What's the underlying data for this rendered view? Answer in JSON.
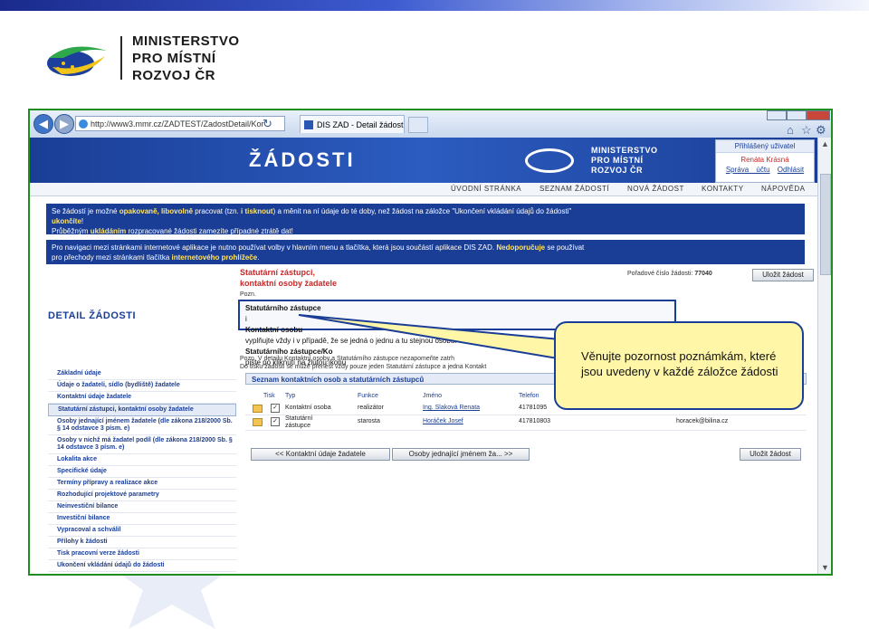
{
  "slide": {
    "brand_lines": [
      "MINISTERSTVO",
      "PRO MÍSTNÍ",
      "ROZVOJ ČR"
    ],
    "callout_text": "Věnujte pozornost poznámkám, které jsou uvedeny v každé záložce žádosti"
  },
  "browser": {
    "address": "http://www3.mmr.cz/ZADTEST/ZadostDetail/Kor",
    "tab_title": "DIS ZAD - Detail žádosti - K..."
  },
  "app": {
    "banner_title": "ŽÁDOSTI",
    "banner_brand": [
      "MINISTERSTVO",
      "PRO MÍSTNÍ",
      "ROZVOJ ČR"
    ],
    "user_box": {
      "header": "Přihlášený uživatel",
      "name": "Renáta Krásná",
      "link_account": "Správa účtu",
      "link_logout": "Odhlásit"
    },
    "menu": [
      "ÚVODNÍ STRÁNKA",
      "SEZNAM ŽÁDOSTÍ",
      "NOVÁ ŽÁDOST",
      "KONTAKTY",
      "NÁPOVĚDA"
    ],
    "notice1": {
      "l1a": "Se žádostí je možné ",
      "l1b": "opakovaně, libovolně",
      "l1c": " pracovat (tzn. ",
      "l1d": "i tisknout",
      "l1e": ") a měnit na ní údaje do té doby, než žádost na záložce \"Ukončení vkládání údajů do žádosti\"",
      "l2a": "ukončíte",
      "l2b": "!",
      "l3a": "Průběžným ",
      "l3b": "ukládáním",
      "l3c": " rozpracované žádosti zamezíte případné ztrátě dat!"
    },
    "notice2": {
      "l1a": "Pro navigaci mezi stránkami internetové aplikace je nutno používat volby v hlavním menu a tlačítka, která jsou součástí aplikace DIS ZAD. ",
      "l1b": "Nedoporučuje",
      "l1c": " se používat",
      "l2a": "pro přechody mezi stránkami tlačítka ",
      "l2b": "internetového prohlížeče",
      "l2c": "."
    },
    "detail_title": "DETAIL ŽÁDOSTI",
    "sidebar": [
      "Základní údaje",
      "Údaje o žadateli, sídlo (bydliště) žadatele",
      "Kontaktní údaje žadatele",
      "Statutární zástupci, kontaktní osoby žadatele",
      "Osoby jednající jménem žadatele (dle zákona 218/2000 Sb. § 14 odstavce 3 písm. e)",
      "Osoby v nichž má žadatel podíl (dle zákona 218/2000 Sb. § 14 odstavce 3 písm. e)",
      "Lokalita akce",
      "Specifické údaje",
      "Termíny přípravy a realizace akce",
      "Rozhodující projektové parametry",
      "Neinvestiční bilance",
      "Investiční bilance",
      "Vypracoval a schválil",
      "Přílohy k žádosti",
      "Tisk pracovní verze žádosti",
      "Ukončení vkládání údajů do žádosti"
    ],
    "section_title_1": "Statutární zástupci,",
    "section_title_2": "kontaktní osoby žadatele",
    "poz_label": "Pozn.",
    "poradove_label": "Pořadové číslo žádosti:",
    "poradove_value": "77040",
    "save_button": "Uložit žádost",
    "highlight_line1_a": "Statutárního zástupce",
    "highlight_line1_b": " i ",
    "highlight_line1_c": "Kontaktní osobu",
    "highlight_line1_d": " vyplňujte vždy i v případě, že se jedná o jednu a tu stejnou osobu!",
    "highlight_line2_a": "Statutárního zástupce/Ko",
    "highlight_line2_b": "                    pište po kliknutí na žlutou ikonu",
    "poz2_line1": "Pozn. V detailu Kontaktní osoby a Statutárního zástupce nezapomeňte zatrh",
    "poz2_line2": "Do tisku žádosti se může přenést vždy pouze jeden Statutární zástupce a jedna Kontakt",
    "table_title": "Seznam kontaktních osob a statutárních zástupců",
    "table_headers": [
      "Tisk",
      "Typ",
      "Funkce",
      "Jméno",
      "Telefon"
    ],
    "rows": [
      {
        "typ": "Kontaktní osoba",
        "funkce": "realizátor",
        "jmeno": "Ing. Slaková Renata",
        "telefon": "41781095",
        "email": ""
      },
      {
        "typ": "Statutární zástupce",
        "funkce": "starosta",
        "jmeno": "Horáček Josef",
        "telefon": "417810803",
        "email": "horacek@bilina.cz"
      }
    ],
    "btn_prev": "<< Kontaktní údaje žadatele",
    "btn_next": "Osoby jednající jménem ža... >>",
    "btn_save_bottom": "Uložit žádost"
  }
}
